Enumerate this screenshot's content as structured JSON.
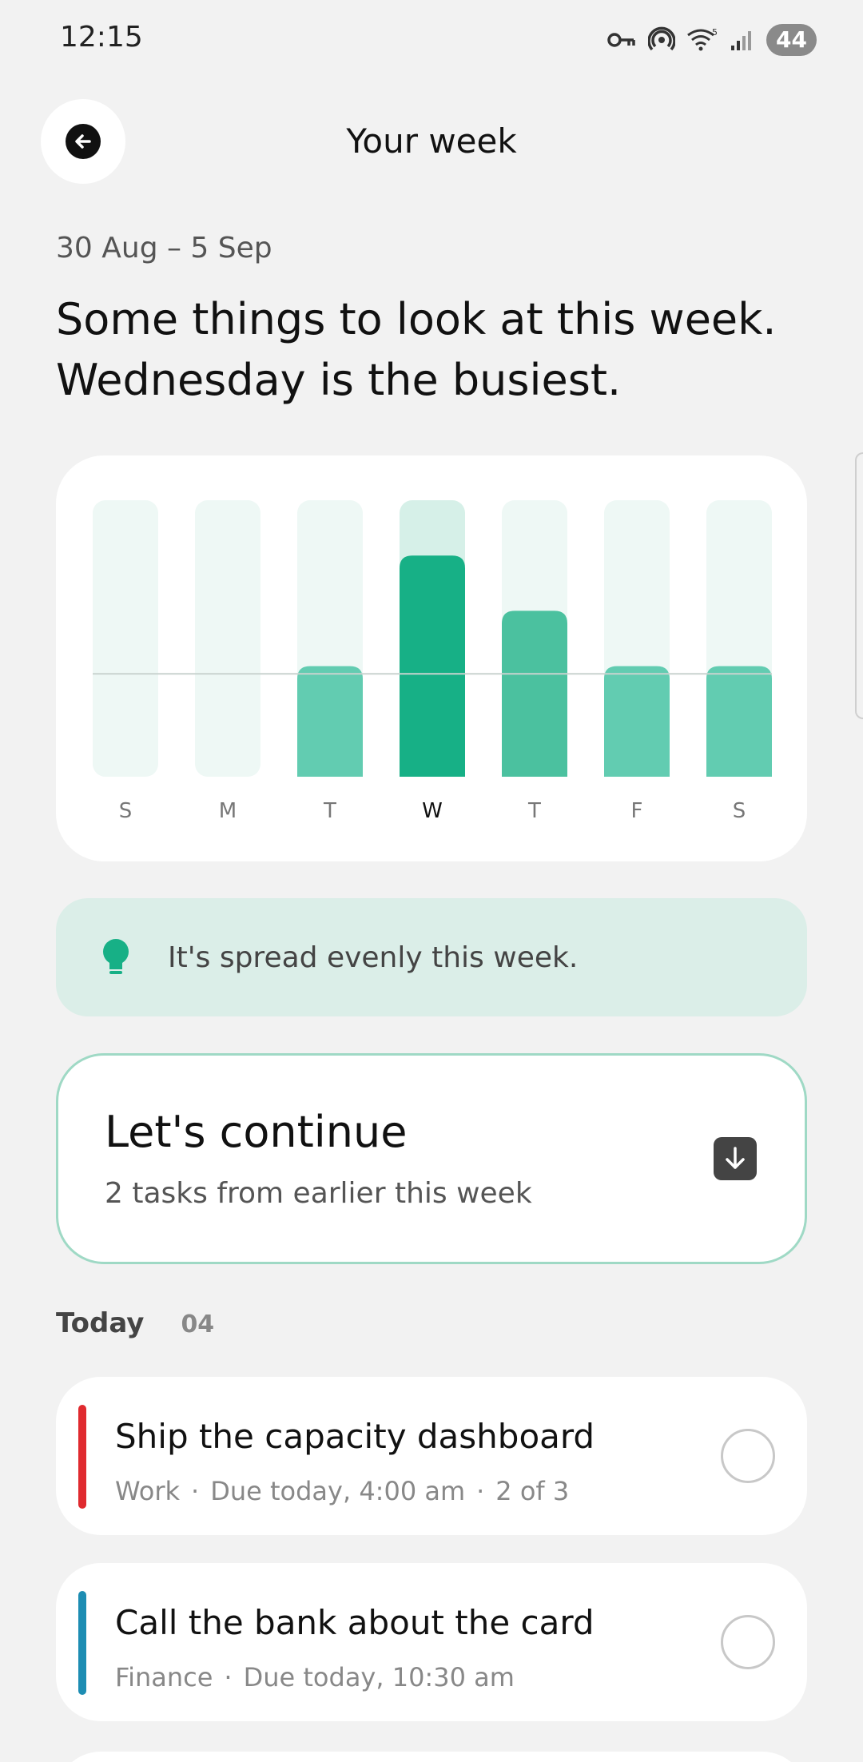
{
  "status": {
    "time": "12:15",
    "battery": "44",
    "icons": [
      "key-icon",
      "hotspot-icon",
      "wifi-icon",
      "signal-icon"
    ]
  },
  "header": {
    "title": "Your week",
    "back_icon": "arrow-left-icon"
  },
  "summary": {
    "date_range": "30 Aug – 5 Sep",
    "headline": "Some things to look at this week. Wednesday is the busiest."
  },
  "chart_data": {
    "type": "bar",
    "categories": [
      "S",
      "M",
      "T",
      "W",
      "T",
      "F",
      "S"
    ],
    "values": [
      0,
      0,
      1,
      2,
      1.5,
      1,
      1
    ],
    "highlight_index": 3,
    "average_line": 0.93,
    "ylim": [
      0,
      2.5
    ],
    "colors": {
      "track": "#eef8f5",
      "track_highlight": "#d6f0e8",
      "bar": "#62ccb1",
      "bar_medium": "#4bc19f",
      "bar_highlight": "#17b086",
      "avg_line": "#c9d3cf"
    }
  },
  "tip": {
    "icon": "lightbulb-icon",
    "text": "It's spread evenly this week."
  },
  "continue_card": {
    "title": "Let's continue",
    "subtitle": "2 tasks from earlier this week",
    "icon": "arrow-down-icon"
  },
  "today": {
    "label": "Today",
    "count": "04",
    "tasks": [
      {
        "title": "Ship the capacity dashboard",
        "category": "Work",
        "due": "Due today, 4:00 am",
        "progress": "2 of 3",
        "color": "#e02a2f"
      },
      {
        "title": "Call the bank about the card",
        "category": "Finance",
        "due": "Due today, 10:30 am",
        "color": "#1d8db3"
      }
    ]
  }
}
